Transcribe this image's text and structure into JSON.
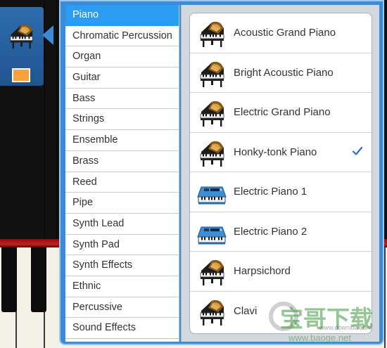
{
  "categories": {
    "selected_index": 0,
    "items": [
      "Piano",
      "Chromatic Percussion",
      "Organ",
      "Guitar",
      "Bass",
      "Strings",
      "Ensemble",
      "Brass",
      "Reed",
      "Pipe",
      "Synth Lead",
      "Synth Pad",
      "Synth Effects",
      "Ethnic",
      "Percussive",
      "Sound Effects"
    ]
  },
  "instruments": {
    "items": [
      {
        "label": "Acoustic Grand Piano",
        "icon": "grand-piano-icon",
        "checked": false
      },
      {
        "label": "Bright Acoustic Piano",
        "icon": "grand-piano-icon",
        "checked": false
      },
      {
        "label": "Electric Grand Piano",
        "icon": "grand-piano-icon",
        "checked": false
      },
      {
        "label": "Honky-tonk Piano",
        "icon": "grand-piano-icon",
        "checked": true
      },
      {
        "label": "Electric Piano 1",
        "icon": "keyboard-synth-icon",
        "checked": false
      },
      {
        "label": "Electric Piano 2",
        "icon": "keyboard-synth-icon",
        "checked": false
      },
      {
        "label": "Harpsichord",
        "icon": "grand-piano-icon",
        "checked": false
      },
      {
        "label": "Clavi",
        "icon": "grand-piano-icon",
        "checked": false
      }
    ]
  },
  "track": {
    "icon": "grand-piano-icon",
    "swatch_color": "#f7a23a"
  },
  "colors": {
    "popover": "#3a8bd8",
    "selected_category": "#2b9cf2",
    "check": "#2b6fc0"
  },
  "watermark": {
    "title": "宝哥下载",
    "url_small": "www.downxia.com",
    "url_main": "www.baoge.net"
  }
}
